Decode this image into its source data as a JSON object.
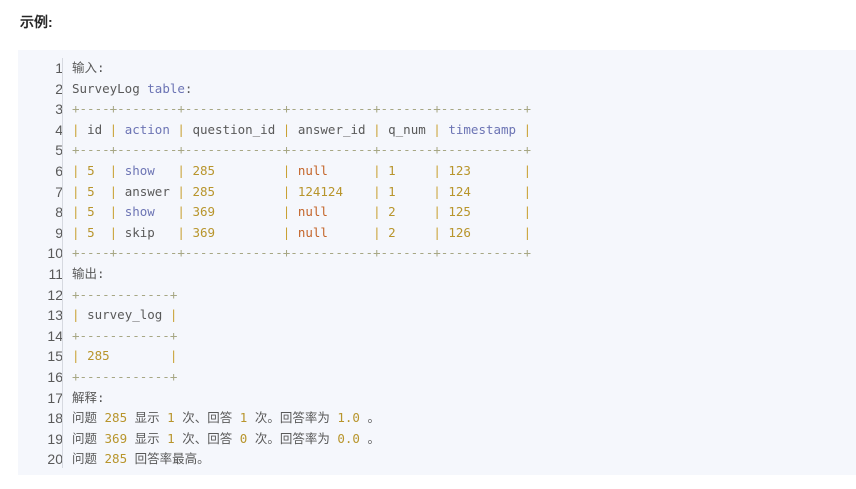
{
  "title": "示例:",
  "code_lines": [
    [
      [
        "输入:",
        "t"
      ]
    ],
    [
      [
        "SurveyLog ",
        "t"
      ],
      [
        "table",
        "k"
      ],
      [
        ":",
        "t"
      ]
    ],
    [
      [
        "+----+--------+-------------+-----------+-------+-----------+",
        "d"
      ]
    ],
    [
      [
        "| ",
        "p"
      ],
      [
        "id",
        "t"
      ],
      [
        " | ",
        "p"
      ],
      [
        "action",
        "k"
      ],
      [
        " | ",
        "p"
      ],
      [
        "question_id",
        "t"
      ],
      [
        " | ",
        "p"
      ],
      [
        "answer_id",
        "t"
      ],
      [
        " | ",
        "p"
      ],
      [
        "q_num",
        "t"
      ],
      [
        " | ",
        "p"
      ],
      [
        "timestamp",
        "k"
      ],
      [
        " |",
        "p"
      ]
    ],
    [
      [
        "+----+--------+-------------+-----------+-------+-----------+",
        "d"
      ]
    ],
    [
      [
        "| ",
        "p"
      ],
      [
        "5",
        "n"
      ],
      [
        "  | ",
        "p"
      ],
      [
        "show",
        "k"
      ],
      [
        "   | ",
        "p"
      ],
      [
        "285",
        "n"
      ],
      [
        "         | ",
        "p"
      ],
      [
        "null",
        "nl"
      ],
      [
        "      | ",
        "p"
      ],
      [
        "1",
        "n"
      ],
      [
        "     | ",
        "p"
      ],
      [
        "123",
        "n"
      ],
      [
        "       |",
        "p"
      ]
    ],
    [
      [
        "| ",
        "p"
      ],
      [
        "5",
        "n"
      ],
      [
        "  | ",
        "p"
      ],
      [
        "answer",
        "t"
      ],
      [
        " | ",
        "p"
      ],
      [
        "285",
        "n"
      ],
      [
        "         | ",
        "p"
      ],
      [
        "124124",
        "n"
      ],
      [
        "    | ",
        "p"
      ],
      [
        "1",
        "n"
      ],
      [
        "     | ",
        "p"
      ],
      [
        "124",
        "n"
      ],
      [
        "       |",
        "p"
      ]
    ],
    [
      [
        "| ",
        "p"
      ],
      [
        "5",
        "n"
      ],
      [
        "  | ",
        "p"
      ],
      [
        "show",
        "k"
      ],
      [
        "   | ",
        "p"
      ],
      [
        "369",
        "n"
      ],
      [
        "         | ",
        "p"
      ],
      [
        "null",
        "nl"
      ],
      [
        "      | ",
        "p"
      ],
      [
        "2",
        "n"
      ],
      [
        "     | ",
        "p"
      ],
      [
        "125",
        "n"
      ],
      [
        "       |",
        "p"
      ]
    ],
    [
      [
        "| ",
        "p"
      ],
      [
        "5",
        "n"
      ],
      [
        "  | ",
        "p"
      ],
      [
        "skip",
        "t"
      ],
      [
        "   | ",
        "p"
      ],
      [
        "369",
        "n"
      ],
      [
        "         | ",
        "p"
      ],
      [
        "null",
        "nl"
      ],
      [
        "      | ",
        "p"
      ],
      [
        "2",
        "n"
      ],
      [
        "     | ",
        "p"
      ],
      [
        "126",
        "n"
      ],
      [
        "       |",
        "p"
      ]
    ],
    [
      [
        "+----+--------+-------------+-----------+-------+-----------+",
        "d"
      ]
    ],
    [
      [
        "输出:",
        "t"
      ]
    ],
    [
      [
        "+------------+",
        "d"
      ]
    ],
    [
      [
        "| ",
        "p"
      ],
      [
        "survey_log",
        "t"
      ],
      [
        " |",
        "p"
      ]
    ],
    [
      [
        "+------------+",
        "d"
      ]
    ],
    [
      [
        "| ",
        "p"
      ],
      [
        "285",
        "n"
      ],
      [
        "        |",
        "p"
      ]
    ],
    [
      [
        "+------------+",
        "d"
      ]
    ],
    [
      [
        "解释:",
        "t"
      ]
    ],
    [
      [
        "问题 ",
        "t"
      ],
      [
        "285",
        "n"
      ],
      [
        " 显示 ",
        "t"
      ],
      [
        "1",
        "n"
      ],
      [
        " 次、回答 ",
        "t"
      ],
      [
        "1",
        "n"
      ],
      [
        " 次。回答率为 ",
        "t"
      ],
      [
        "1.0",
        "n"
      ],
      [
        " 。",
        "t"
      ]
    ],
    [
      [
        "问题 ",
        "t"
      ],
      [
        "369",
        "n"
      ],
      [
        " 显示 ",
        "t"
      ],
      [
        "1",
        "n"
      ],
      [
        " 次、回答 ",
        "t"
      ],
      [
        "0",
        "n"
      ],
      [
        " 次。回答率为 ",
        "t"
      ],
      [
        "0.0",
        "n"
      ],
      [
        " 。",
        "t"
      ]
    ],
    [
      [
        "问题 ",
        "t"
      ],
      [
        "285",
        "n"
      ],
      [
        " 回答率最高。",
        "t"
      ]
    ]
  ]
}
